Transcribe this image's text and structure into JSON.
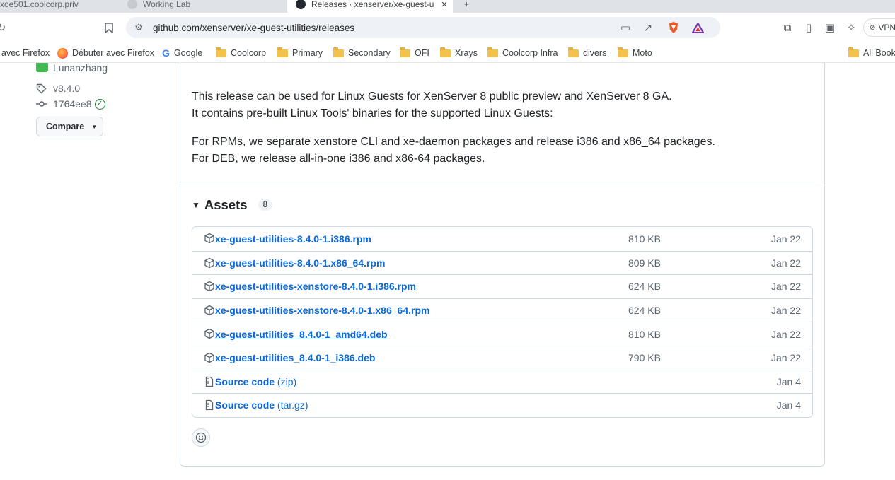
{
  "browser": {
    "tabs": [
      {
        "label": "xoe501.coolcorp.priv"
      },
      {
        "label": "Working Lab"
      },
      {
        "label": "Releases · xenserver/xe-guest-u"
      }
    ],
    "url": "github.com/xenserver/xe-guest-utilities/releases",
    "vpn_label": "VPN",
    "bookmarks": [
      {
        "label": "avec Firefox",
        "icon": "none"
      },
      {
        "label": "Débuter avec Firefox",
        "icon": "firefox-icon"
      },
      {
        "label": "Google",
        "icon": "google-icon"
      },
      {
        "label": "Coolcorp",
        "icon": "folder-icon"
      },
      {
        "label": "Primary",
        "icon": "folder-icon"
      },
      {
        "label": "Secondary",
        "icon": "folder-icon"
      },
      {
        "label": "OFI",
        "icon": "folder-icon"
      },
      {
        "label": "Xrays",
        "icon": "folder-icon"
      },
      {
        "label": "Coolcorp Infra",
        "icon": "folder-icon"
      },
      {
        "label": "divers",
        "icon": "folder-icon"
      },
      {
        "label": "Moto",
        "icon": "folder-icon"
      }
    ],
    "all_bookmarks_label": "All Book"
  },
  "sidebar": {
    "author": "Lunanzhang",
    "tag": "v8.4.0",
    "commit": "1764ee8",
    "compare_label": "Compare"
  },
  "release": {
    "paragraph1_line1": "This release can be used for Linux Guests for XenServer 8 public preview and XenServer 8 GA.",
    "paragraph1_line2": "It contains pre-built Linux Tools' binaries for the supported Linux Guests:",
    "paragraph2_line1": "For RPMs, we separate xenstore CLI and xe-daemon packages and release i386 and x86_64 packages.",
    "paragraph2_line2": "For DEB, we release all-in-one i386 and x86-64 packages."
  },
  "assets": {
    "title": "Assets",
    "count": "8",
    "items": [
      {
        "name": "xe-guest-utilities-8.4.0-1.i386.rpm",
        "suffix": "",
        "size": "810 KB",
        "date": "Jan 22",
        "icon": "package-icon"
      },
      {
        "name": "xe-guest-utilities-8.4.0-1.x86_64.rpm",
        "suffix": "",
        "size": "809 KB",
        "date": "Jan 22",
        "icon": "package-icon"
      },
      {
        "name": "xe-guest-utilities-xenstore-8.4.0-1.i386.rpm",
        "suffix": "",
        "size": "624 KB",
        "date": "Jan 22",
        "icon": "package-icon"
      },
      {
        "name": "xe-guest-utilities-xenstore-8.4.0-1.x86_64.rpm",
        "suffix": "",
        "size": "624 KB",
        "date": "Jan 22",
        "icon": "package-icon"
      },
      {
        "name": "xe-guest-utilities_8.4.0-1_amd64.deb",
        "suffix": "",
        "size": "810 KB",
        "date": "Jan 22",
        "icon": "package-icon"
      },
      {
        "name": "xe-guest-utilities_8.4.0-1_i386.deb",
        "suffix": "",
        "size": "790 KB",
        "date": "Jan 22",
        "icon": "package-icon"
      },
      {
        "name": "Source code",
        "suffix": " (zip)",
        "size": "",
        "date": "Jan 4",
        "icon": "file-zip-icon"
      },
      {
        "name": "Source code",
        "suffix": " (tar.gz)",
        "size": "",
        "date": "Jan 4",
        "icon": "file-zip-icon"
      }
    ]
  }
}
